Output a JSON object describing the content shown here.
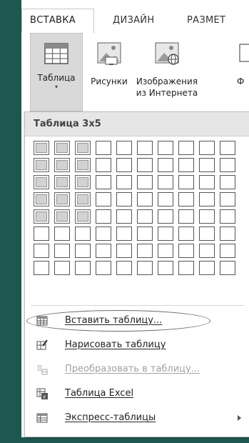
{
  "ribbon": {
    "tabs": [
      {
        "label": "ВСТАВКА",
        "active": true
      },
      {
        "label": "ДИЗАЙН"
      },
      {
        "label": "РАЗМЕТ"
      }
    ],
    "buttons": [
      {
        "label": "Таблица",
        "icon": "table-icon"
      },
      {
        "label": "Рисунки",
        "icon": "picture-icon"
      },
      {
        "label": "Изображения",
        "label2": "из Интернета",
        "icon": "online-picture-icon"
      },
      {
        "label": "Ф",
        "icon": "shapes-icon"
      }
    ]
  },
  "dropdown": {
    "header": "Таблица 3x5",
    "grid": {
      "cols": 10,
      "rows": 8,
      "selected_cols": 3,
      "selected_rows": 5
    },
    "items": [
      {
        "label": "Вставить таблицу...",
        "icon": "insert-table-icon",
        "enabled": true,
        "highlighted": true
      },
      {
        "label": "Нарисовать таблицу",
        "icon": "draw-table-icon",
        "enabled": true
      },
      {
        "label": "Преобразовать в таблицу...",
        "icon": "convert-to-table-icon",
        "enabled": false
      },
      {
        "label": "Таблица Excel",
        "icon": "excel-table-icon",
        "enabled": true
      },
      {
        "label": "Экспресс-таблицы",
        "icon": "quick-tables-icon",
        "enabled": true,
        "submenu": true
      }
    ]
  },
  "colors": {
    "side_stripe": "#1f5650",
    "selected_cell": "#d2d2d2",
    "ribbon_bg": "#ffffff"
  }
}
